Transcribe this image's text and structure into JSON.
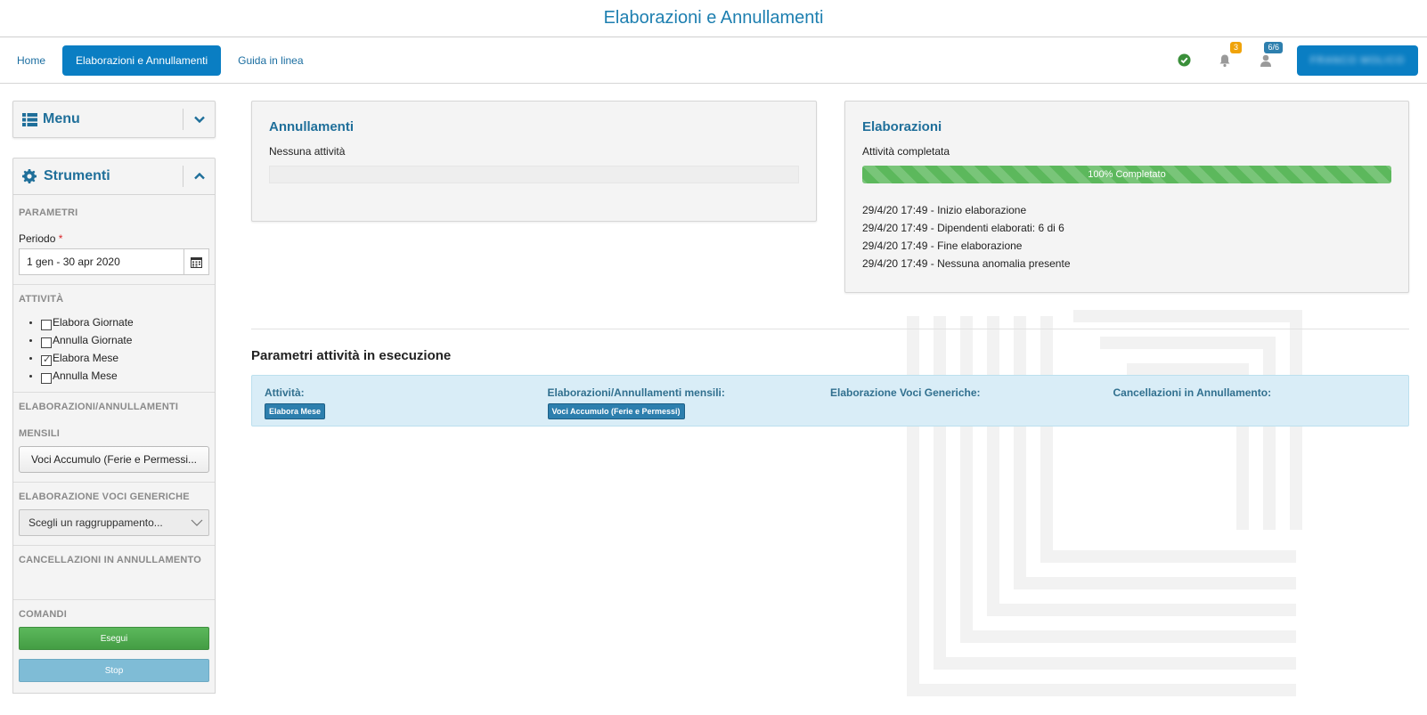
{
  "page": {
    "title": "Elaborazioni e Annullamenti"
  },
  "nav": {
    "home": "Home",
    "active": "Elaborazioni e Annullamenti",
    "guide": "Guida in linea",
    "notifications_count": "3",
    "users_count": "6/6",
    "user_name": "FRANCO MOLICO"
  },
  "sidebar": {
    "menu_title": "Menu",
    "tools_title": "Strumenti",
    "params_label": "PARAMETRI",
    "period_label": "Periodo",
    "period_required": "*",
    "period_value": "1 gen - 30 apr 2020",
    "activities_label": "ATTIVITÀ",
    "activities": [
      {
        "label": "Elabora Giornate",
        "checked": false
      },
      {
        "label": "Annulla Giornate",
        "checked": false
      },
      {
        "label": "Elabora Mese",
        "checked": true
      },
      {
        "label": "Annulla Mese",
        "checked": false
      }
    ],
    "monthly_label_1": "ELABORAZIONI/ANNULLAMENTI",
    "monthly_label_2": "MENSILI",
    "monthly_value": "Voci Accumulo (Ferie e Permessi...",
    "generic_label": "ELABORAZIONE VOCI GENERICHE",
    "generic_placeholder": "Scegli un raggruppamento...",
    "cancel_label": "CANCELLAZIONI IN ANNULLAMENTO",
    "commands_label": "COMANDI",
    "run_label": "Esegui",
    "stop_label": "Stop"
  },
  "annullamenti": {
    "title": "Annullamenti",
    "status": "Nessuna attività"
  },
  "elaborazioni": {
    "title": "Elaborazioni",
    "status": "Attività completata",
    "progress_percent": 100,
    "progress_text": "100% Completato",
    "log": [
      "29/4/20 17:49 - Inizio elaborazione",
      "29/4/20 17:49 - Dipendenti elaborati: 6 di 6",
      "29/4/20 17:49 - Fine elaborazione",
      "29/4/20 17:49 - Nessuna anomalia presente"
    ]
  },
  "params": {
    "title": "Parametri attività in esecuzione",
    "cols": [
      {
        "head": "Attività:",
        "tag": "Elabora Mese"
      },
      {
        "head": "Elaborazioni/Annullamenti mensili:",
        "tag": "Voci Accumulo (Ferie e Permessi)"
      },
      {
        "head": "Elaborazione Voci Generiche:",
        "tag": ""
      },
      {
        "head": "Cancellazioni in Annullamento:",
        "tag": ""
      }
    ]
  },
  "colors": {
    "primary": "#0a7ec3",
    "heading": "#1f6f9a",
    "success": "#5cb85c",
    "info_bg": "#d9edf7",
    "badge_orange": "#f0a30a"
  },
  "icons": {
    "status": "check-circle-icon",
    "notifications": "bell-icon",
    "users": "user-icon",
    "menu": "list-icon",
    "tools": "gear-icon",
    "calendar": "calendar-icon"
  }
}
